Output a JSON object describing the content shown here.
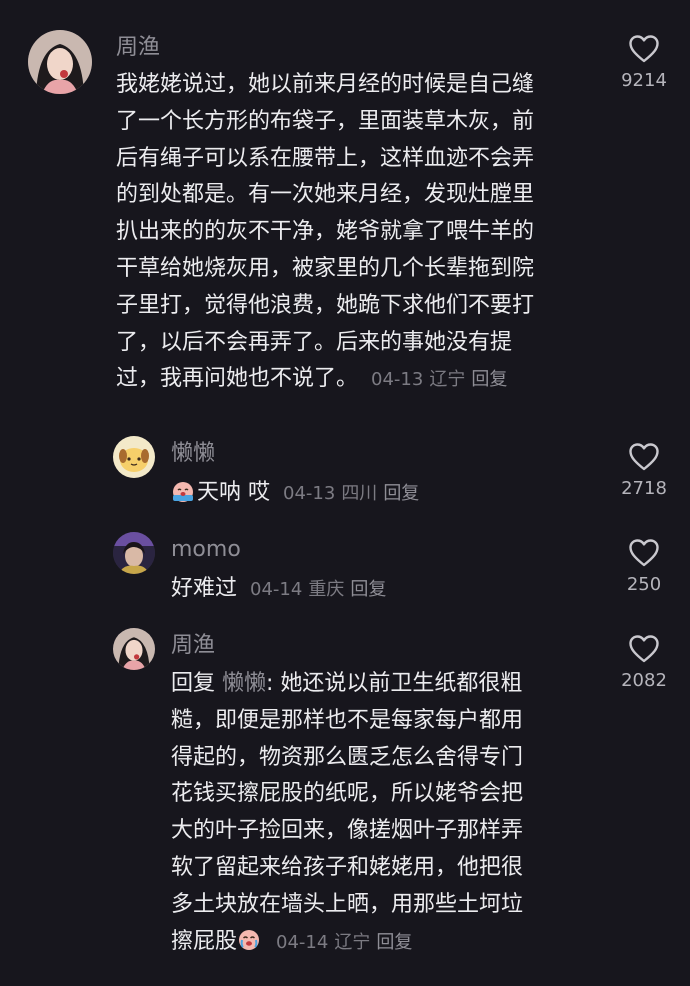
{
  "comments": [
    {
      "user": "周渔",
      "lines": [
        "我姥姥说过，她以前来月经的时候是自己缝",
        "了一个长方形的布袋子，里面装草木灰，前",
        "后有绳子可以系在腰带上，这样血迹不会弄",
        "的到处都是。有一次她来月经，发现灶膛里",
        "扒出来的的灰不干净，姥爷就拿了喂牛羊的",
        "干草给她烧灰用，被家里的几个长辈拖到院",
        "子里打，觉得他浪费，她跪下求他们不要打",
        "了，以后不会再弄了。后来的事她没有提"
      ],
      "last_line": "过，我再问她也不说了。",
      "date": "04-13",
      "location": "辽宁",
      "reply_label": "回复",
      "likes": "9214",
      "like_icon": "heart-outline-icon"
    },
    {
      "user": "懒懒",
      "emoji": "crying-face-emoji",
      "text": "天呐 哎",
      "date": "04-13",
      "location": "四川",
      "reply_label": "回复",
      "likes": "2718",
      "like_icon": "heart-outline-icon"
    },
    {
      "user": "momo",
      "text": "好难过",
      "date": "04-14",
      "location": "重庆",
      "reply_label": "回复",
      "likes": "250",
      "like_icon": "heart-outline-icon"
    },
    {
      "user": "周渔",
      "reply_prefix": "回复",
      "reply_to": "懒懒",
      "first_line_text": ": 她还说以前卫生纸都很粗",
      "lines": [
        "糙，即便是那样也不是每家每户都用",
        "得起的，物资那么匮乏怎么舍得专门",
        "花钱买擦屁股的纸呢，所以姥爷会把",
        "大的叶子捡回来，像搓烟叶子那样弄",
        "软了留起来给孩子和姥姥用，他把很",
        "多土块放在墙头上晒，用那些土坷垃"
      ],
      "last_line": "擦屁股",
      "emoji": "crying-face-emoji",
      "date": "04-14",
      "location": "辽宁",
      "reply_label": "回复",
      "likes": "2082",
      "like_icon": "heart-outline-icon"
    }
  ],
  "colors": {
    "background": "#17161d",
    "text_primary": "#ececef",
    "text_secondary": "#8f8e96",
    "meta": "#7c7b83"
  }
}
